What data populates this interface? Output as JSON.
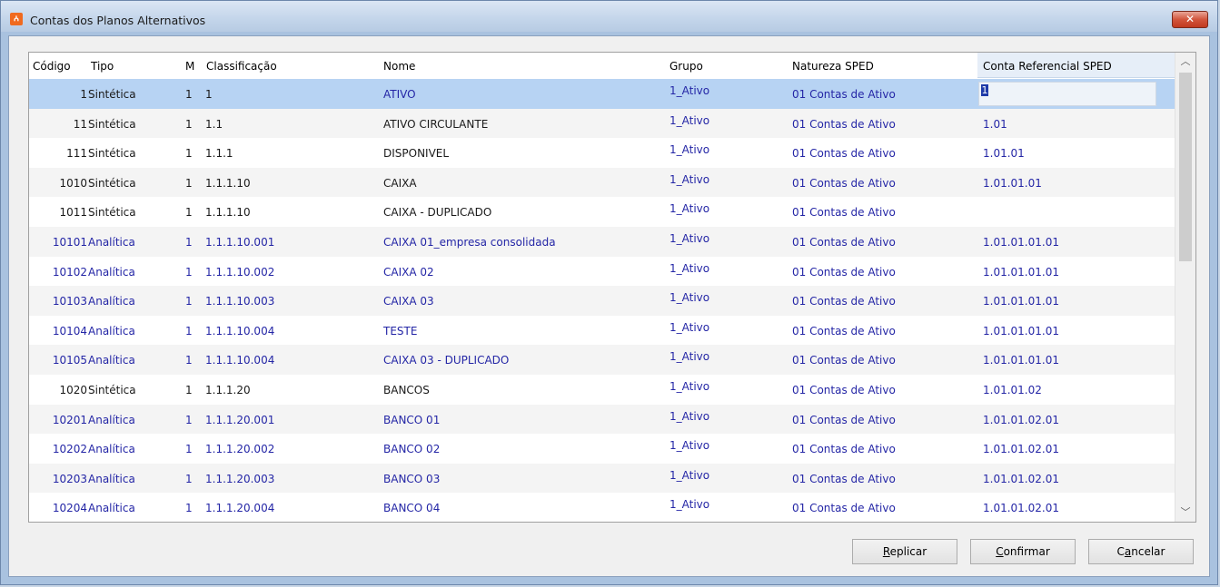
{
  "window": {
    "title": "Contas dos Planos Alternativos",
    "close_label": "✕"
  },
  "columns": [
    "Código",
    "Tipo",
    "M",
    "Classificação",
    "Nome",
    "Grupo",
    "Natureza SPED",
    "Conta Referencial SPED"
  ],
  "editing_value": "1",
  "rows": [
    {
      "codigo": "1",
      "tipo": "Sintética",
      "m": "1",
      "classificacao": "1",
      "nome": "ATIVO",
      "grupo": "1_Ativo",
      "natureza": "01 Contas de Ativo",
      "ref": ""
    },
    {
      "codigo": "11",
      "tipo": "Sintética",
      "m": "1",
      "classificacao": "1.1",
      "nome": "ATIVO CIRCULANTE",
      "grupo": "1_Ativo",
      "natureza": "01 Contas de Ativo",
      "ref": "1.01"
    },
    {
      "codigo": "111",
      "tipo": "Sintética",
      "m": "1",
      "classificacao": "1.1.1",
      "nome": "DISPONIVEL",
      "grupo": "1_Ativo",
      "natureza": "01 Contas de Ativo",
      "ref": "1.01.01"
    },
    {
      "codigo": "1010",
      "tipo": "Sintética",
      "m": "1",
      "classificacao": "1.1.1.10",
      "nome": "CAIXA",
      "grupo": "1_Ativo",
      "natureza": "01 Contas de Ativo",
      "ref": "1.01.01.01"
    },
    {
      "codigo": "1011",
      "tipo": "Sintética",
      "m": "1",
      "classificacao": "1.1.1.10",
      "nome": "CAIXA - DUPLICADO",
      "grupo": "1_Ativo",
      "natureza": "01 Contas de Ativo",
      "ref": ""
    },
    {
      "codigo": "10101",
      "tipo": "Analítica",
      "m": "1",
      "classificacao": "1.1.1.10.001",
      "nome": "CAIXA 01_empresa consolidada",
      "grupo": "1_Ativo",
      "natureza": "01 Contas de Ativo",
      "ref": "1.01.01.01.01"
    },
    {
      "codigo": "10102",
      "tipo": "Analítica",
      "m": "1",
      "classificacao": "1.1.1.10.002",
      "nome": "CAIXA 02",
      "grupo": "1_Ativo",
      "natureza": "01 Contas de Ativo",
      "ref": "1.01.01.01.01"
    },
    {
      "codigo": "10103",
      "tipo": "Analítica",
      "m": "1",
      "classificacao": "1.1.1.10.003",
      "nome": "CAIXA 03",
      "grupo": "1_Ativo",
      "natureza": "01 Contas de Ativo",
      "ref": "1.01.01.01.01"
    },
    {
      "codigo": "10104",
      "tipo": "Analítica",
      "m": "1",
      "classificacao": "1.1.1.10.004",
      "nome": "TESTE",
      "grupo": "1_Ativo",
      "natureza": "01 Contas de Ativo",
      "ref": "1.01.01.01.01"
    },
    {
      "codigo": "10105",
      "tipo": "Analítica",
      "m": "1",
      "classificacao": "1.1.1.10.004",
      "nome": "CAIXA 03 - DUPLICADO",
      "grupo": "1_Ativo",
      "natureza": "01 Contas de Ativo",
      "ref": "1.01.01.01.01"
    },
    {
      "codigo": "1020",
      "tipo": "Sintética",
      "m": "1",
      "classificacao": "1.1.1.20",
      "nome": "BANCOS",
      "grupo": "1_Ativo",
      "natureza": "01 Contas de Ativo",
      "ref": "1.01.01.02"
    },
    {
      "codigo": "10201",
      "tipo": "Analítica",
      "m": "1",
      "classificacao": "1.1.1.20.001",
      "nome": "BANCO 01",
      "grupo": "1_Ativo",
      "natureza": "01 Contas de Ativo",
      "ref": "1.01.01.02.01"
    },
    {
      "codigo": "10202",
      "tipo": "Analítica",
      "m": "1",
      "classificacao": "1.1.1.20.002",
      "nome": "BANCO 02",
      "grupo": "1_Ativo",
      "natureza": "01 Contas de Ativo",
      "ref": "1.01.01.02.01"
    },
    {
      "codigo": "10203",
      "tipo": "Analítica",
      "m": "1",
      "classificacao": "1.1.1.20.003",
      "nome": "BANCO 03",
      "grupo": "1_Ativo",
      "natureza": "01 Contas de Ativo",
      "ref": "1.01.01.02.01"
    },
    {
      "codigo": "10204",
      "tipo": "Analítica",
      "m": "1",
      "classificacao": "1.1.1.20.004",
      "nome": "BANCO 04",
      "grupo": "1_Ativo",
      "natureza": "01 Contas de Ativo",
      "ref": "1.01.01.02.01"
    }
  ],
  "buttons": {
    "replicar": {
      "accel": "R",
      "rest": "eplicar"
    },
    "confirmar": {
      "accel": "C",
      "rest": "onfirmar"
    },
    "cancelar": {
      "pre": "C",
      "accel": "a",
      "rest": "ncelar"
    }
  },
  "scroll_icons": {
    "up": "chevron-up-icon",
    "down": "chevron-down-icon"
  },
  "colors": {
    "analitica_text": "#2426a6",
    "sintetica_text": "#1a1a1a",
    "blue_column_text": "#2426a6",
    "selected_row": "#b7d3f3",
    "alt_row": "#f4f4f4"
  }
}
